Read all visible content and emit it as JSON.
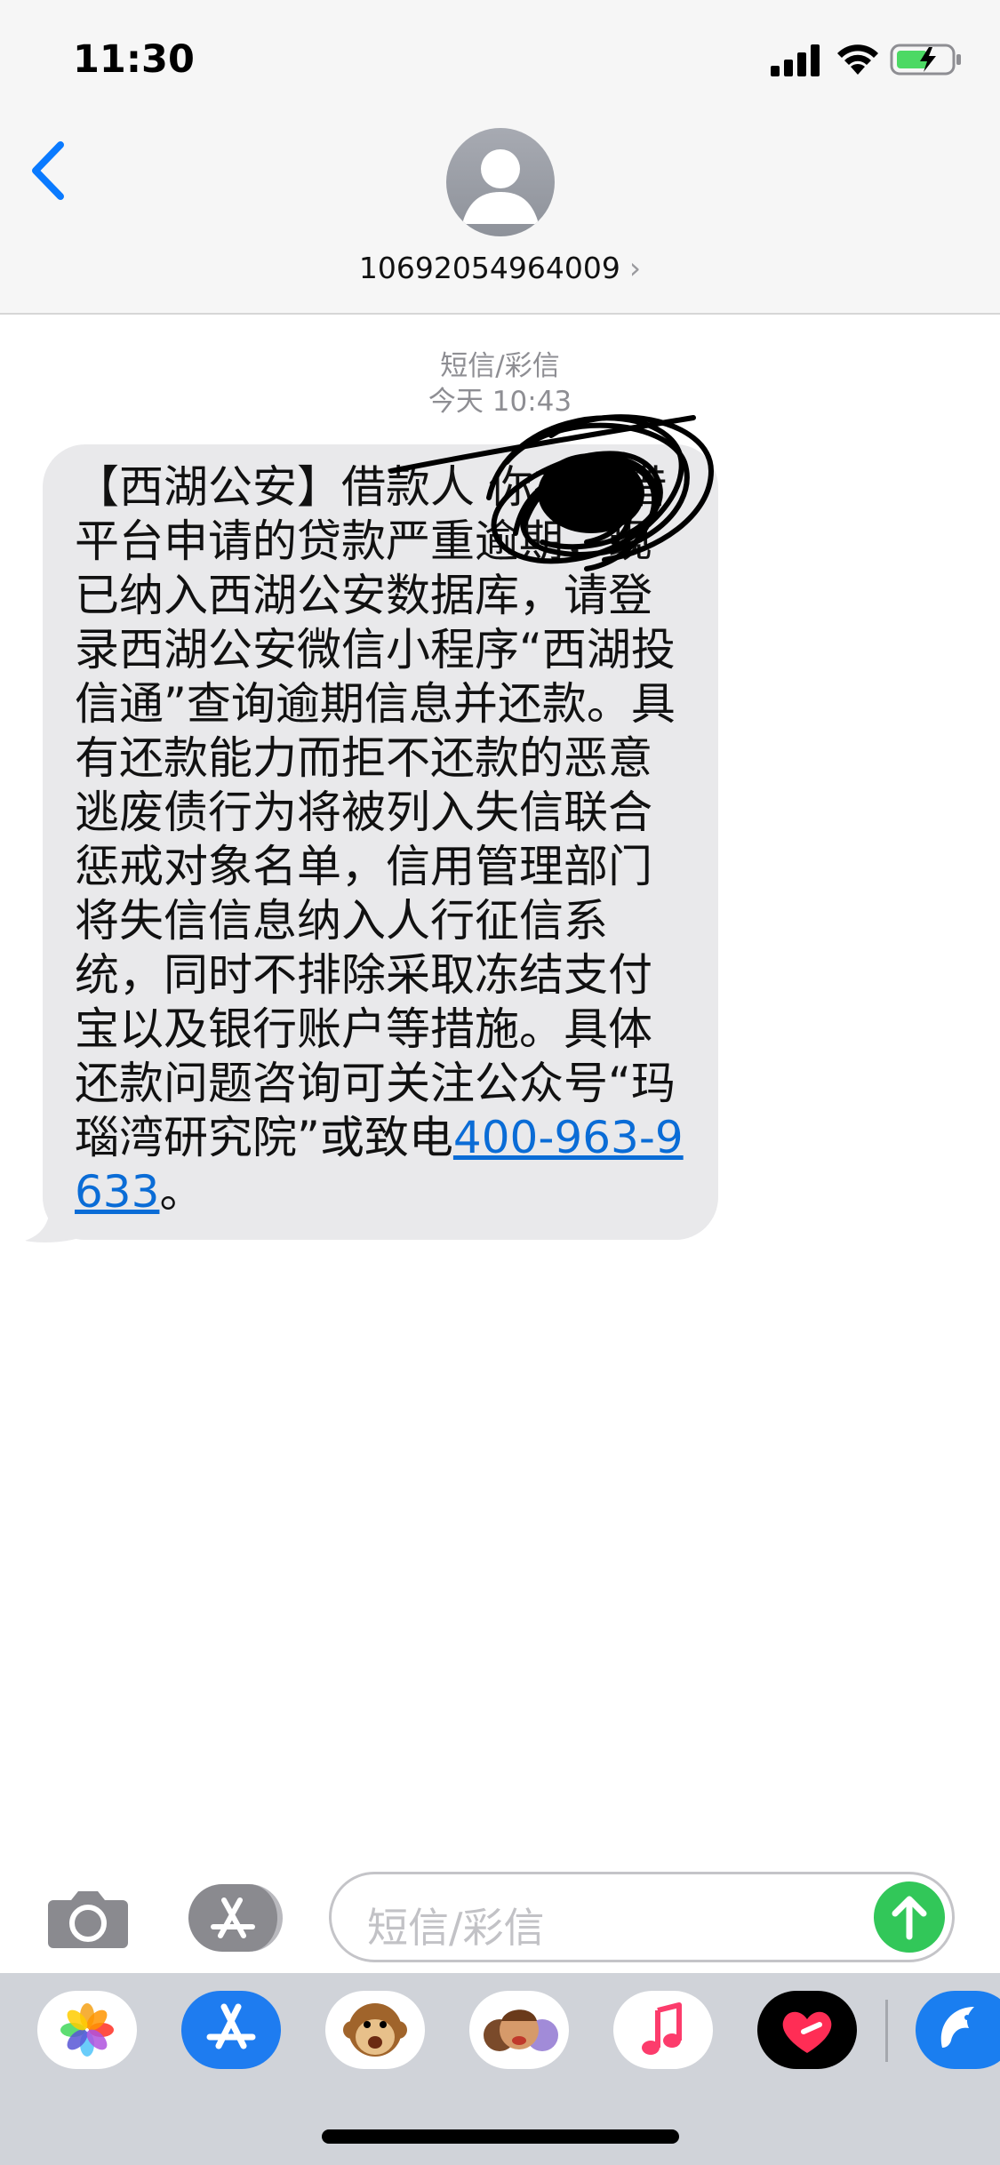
{
  "status_bar": {
    "time": "11:30"
  },
  "header": {
    "contact": "10692054964009",
    "chevron": "›"
  },
  "thread": {
    "service_label": "短信/彩信",
    "timestamp": "今天 10:43"
  },
  "message": {
    "body": "【西湖公安】借款人 你在怡借平台申请的贷款严重逾期，现已纳入西湖公安数据库，请登录西湖公安微信小程序“西湖投信通”查询逾期信息并还款。具有还款能力而拒不还款的恶意逃废债行为将被列入失信联合惩戒对象名单，信用管理部门将失信信息纳入人行征信系统，同时不排除采取冻结支付宝以及银行账户等措施。具体还款问题咨询可关注公众号“玛瑙湾研究院”或致电",
    "phone": "400-963-9633",
    "end": "。"
  },
  "compose": {
    "placeholder": "短信/彩信"
  },
  "colors": {
    "link": "#0a6cd6",
    "bubble": "#e9e9eb",
    "send": "#32c759",
    "back": "#0a7aff"
  },
  "icons": {
    "camera": "camera-icon",
    "appstore": "app-store-icon",
    "send": "send-arrow-icon",
    "back": "back-chevron-icon"
  }
}
